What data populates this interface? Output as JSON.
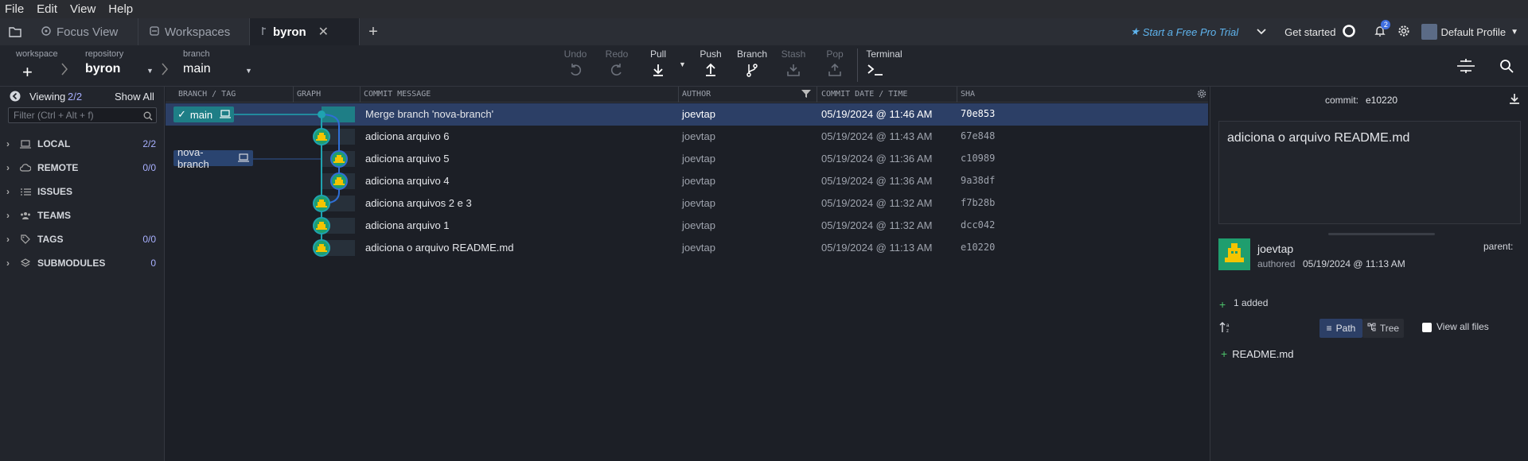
{
  "menu": [
    "File",
    "Edit",
    "View",
    "Help"
  ],
  "tabs": [
    {
      "label": "Focus View"
    },
    {
      "label": "Workspaces"
    },
    {
      "label": "byron"
    }
  ],
  "header_right": {
    "pro_trial": "Start a Free Pro Trial",
    "get_started": "Get started",
    "notification_count": "2",
    "profile": "Default Profile"
  },
  "toolbar": {
    "workspace_label": "workspace",
    "repository_label": "repository",
    "repository_value": "byron",
    "branch_label": "branch",
    "branch_value": "main",
    "undo": "Undo",
    "redo": "Redo",
    "pull": "Pull",
    "push": "Push",
    "branch": "Branch",
    "stash": "Stash",
    "pop": "Pop",
    "terminal": "Terminal"
  },
  "sidebar": {
    "viewing": "Viewing",
    "viewing_count": "2/2",
    "show_all": "Show All",
    "filter_placeholder": "Filter (Ctrl + Alt + f)",
    "sections": [
      {
        "label": "LOCAL",
        "count": "2/2"
      },
      {
        "label": "REMOTE",
        "count": "0/0"
      },
      {
        "label": "ISSUES",
        "count": ""
      },
      {
        "label": "TEAMS",
        "count": ""
      },
      {
        "label": "TAGS",
        "count": "0/0"
      },
      {
        "label": "SUBMODULES",
        "count": "0"
      }
    ]
  },
  "graph_header": {
    "branch_tag": "BRANCH / TAG",
    "graph": "GRAPH",
    "message": "COMMIT MESSAGE",
    "author": "AUTHOR",
    "date": "COMMIT DATE / TIME",
    "sha": "SHA"
  },
  "branches": {
    "main": "main",
    "nova": "nova-branch"
  },
  "commits": [
    {
      "message": "Merge branch 'nova-branch'",
      "author": "joevtap",
      "date": "05/19/2024 @ 11:46 AM",
      "sha": "70e853"
    },
    {
      "message": "adiciona arquivo 6",
      "author": "joevtap",
      "date": "05/19/2024 @ 11:43 AM",
      "sha": "67e848"
    },
    {
      "message": "adiciona arquivo 5",
      "author": "joevtap",
      "date": "05/19/2024 @ 11:36 AM",
      "sha": "c10989"
    },
    {
      "message": "adiciona arquivo 4",
      "author": "joevtap",
      "date": "05/19/2024 @ 11:36 AM",
      "sha": "9a38df"
    },
    {
      "message": "adiciona arquivos 2 e 3",
      "author": "joevtap",
      "date": "05/19/2024 @ 11:32 AM",
      "sha": "f7b28b"
    },
    {
      "message": "adiciona arquivo 1",
      "author": "joevtap",
      "date": "05/19/2024 @ 11:32 AM",
      "sha": "dcc042"
    },
    {
      "message": "adiciona o arquivo README.md",
      "author": "joevtap",
      "date": "05/19/2024 @ 11:13 AM",
      "sha": "e10220"
    }
  ],
  "detail": {
    "commit_label": "commit:",
    "commit_sha": "e10220",
    "message": "adiciona o arquivo README.md",
    "author": "joevtap",
    "authored_label": "authored",
    "authored_date": "05/19/2024 @ 11:13 AM",
    "parent_label": "parent:",
    "added": "1 added",
    "path_label": "Path",
    "tree_label": "Tree",
    "view_all": "View all files",
    "files": [
      "README.md"
    ]
  },
  "colors": {
    "accent": "#1e7e86",
    "selected": "#2c3f66",
    "node_green": "#1f9e6e",
    "avatar_yellow": "#f5c400",
    "link": "#5fb4ee"
  }
}
